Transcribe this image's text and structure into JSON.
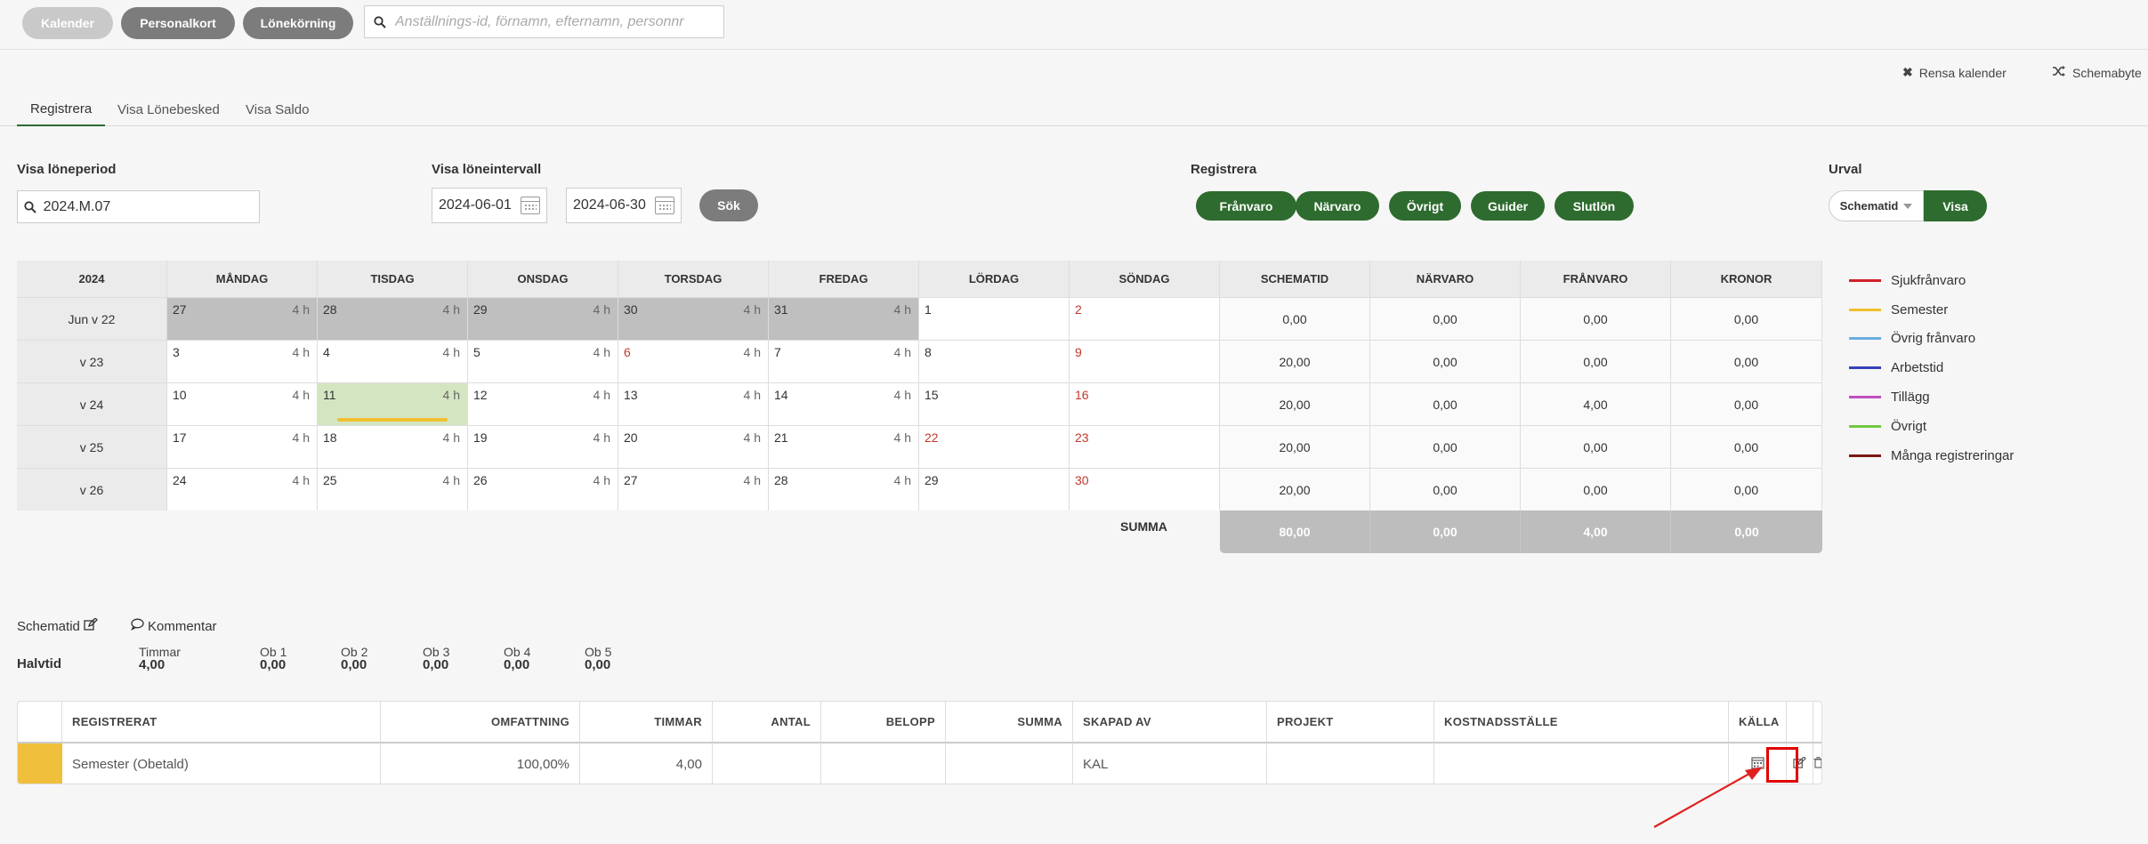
{
  "topnav": {
    "kalender": "Kalender",
    "personalkort": "Personalkort",
    "lonekorning": "Lönekörning",
    "search_placeholder": "Anställnings-id, förnamn, efternamn, personnr"
  },
  "actions": {
    "rensa": "Rensa kalender",
    "schemabyte": "Schemabyte"
  },
  "tabs": [
    "Registrera",
    "Visa Lönebesked",
    "Visa Saldo"
  ],
  "filters": {
    "loneperiod_label": "Visa löneperiod",
    "loneperiod_value": "2024.M.07",
    "intervall_label": "Visa löneintervall",
    "from_date": "2024-06-01",
    "to_date": "2024-06-30",
    "sok": "Sök"
  },
  "registrera": {
    "label": "Registrera",
    "buttons": [
      "Frånvaro",
      "Närvaro",
      "Övrigt",
      "Guider",
      "Slutlön"
    ]
  },
  "urval": {
    "label": "Urval",
    "selected": "Schematid",
    "visa": "Visa"
  },
  "calendar": {
    "year": "2024",
    "day_headers": [
      "MÅNDAG",
      "TISDAG",
      "ONSDAG",
      "TORSDAG",
      "FREDAG",
      "LÖRDAG",
      "SÖNDAG"
    ],
    "sum_headers": [
      "SCHEMATID",
      "NÄRVARO",
      "FRÅNVARO",
      "KRONOR"
    ],
    "weeks": [
      {
        "label": "Jun v 22",
        "days": [
          {
            "n": "27",
            "h": "4 h",
            "state": "past"
          },
          {
            "n": "28",
            "h": "4 h",
            "state": "past"
          },
          {
            "n": "29",
            "h": "4 h",
            "state": "past"
          },
          {
            "n": "30",
            "h": "4 h",
            "state": "past"
          },
          {
            "n": "31",
            "h": "4 h",
            "state": "past"
          },
          {
            "n": "1",
            "h": ""
          },
          {
            "n": "2",
            "h": "",
            "red": true
          }
        ],
        "sums": [
          "0,00",
          "0,00",
          "0,00",
          "0,00"
        ]
      },
      {
        "label": "v 23",
        "days": [
          {
            "n": "3",
            "h": "4 h"
          },
          {
            "n": "4",
            "h": "4 h"
          },
          {
            "n": "5",
            "h": "4 h"
          },
          {
            "n": "6",
            "h": "4 h",
            "red": true
          },
          {
            "n": "7",
            "h": "4 h"
          },
          {
            "n": "8",
            "h": ""
          },
          {
            "n": "9",
            "h": "",
            "red": true
          }
        ],
        "sums": [
          "20,00",
          "0,00",
          "0,00",
          "0,00"
        ]
      },
      {
        "label": "v 24",
        "days": [
          {
            "n": "10",
            "h": "4 h"
          },
          {
            "n": "11",
            "h": "4 h",
            "state": "sel",
            "bar": true
          },
          {
            "n": "12",
            "h": "4 h"
          },
          {
            "n": "13",
            "h": "4 h"
          },
          {
            "n": "14",
            "h": "4 h"
          },
          {
            "n": "15",
            "h": ""
          },
          {
            "n": "16",
            "h": "",
            "red": true
          }
        ],
        "sums": [
          "20,00",
          "0,00",
          "4,00",
          "0,00"
        ]
      },
      {
        "label": "v 25",
        "days": [
          {
            "n": "17",
            "h": "4 h"
          },
          {
            "n": "18",
            "h": "4 h"
          },
          {
            "n": "19",
            "h": "4 h"
          },
          {
            "n": "20",
            "h": "4 h"
          },
          {
            "n": "21",
            "h": "4 h"
          },
          {
            "n": "22",
            "h": "",
            "red": true
          },
          {
            "n": "23",
            "h": "",
            "red": true
          }
        ],
        "sums": [
          "20,00",
          "0,00",
          "0,00",
          "0,00"
        ]
      },
      {
        "label": "v 26",
        "days": [
          {
            "n": "24",
            "h": "4 h"
          },
          {
            "n": "25",
            "h": "4 h"
          },
          {
            "n": "26",
            "h": "4 h"
          },
          {
            "n": "27",
            "h": "4 h"
          },
          {
            "n": "28",
            "h": "4 h"
          },
          {
            "n": "29",
            "h": ""
          },
          {
            "n": "30",
            "h": "",
            "red": true
          }
        ],
        "sums": [
          "20,00",
          "0,00",
          "0,00",
          "0,00"
        ]
      }
    ],
    "summa_label": "SUMMA",
    "totals": [
      "80,00",
      "0,00",
      "4,00",
      "0,00"
    ]
  },
  "legend": [
    {
      "label": "Sjukfrånvaro",
      "color": "#d0202a"
    },
    {
      "label": "Semester",
      "color": "#f0c030"
    },
    {
      "label": "Övrig frånvaro",
      "color": "#6aaee0"
    },
    {
      "label": "Arbetstid",
      "color": "#3840b8"
    },
    {
      "label": "Tillägg",
      "color": "#c050c0"
    },
    {
      "label": "Övrigt",
      "color": "#70c840"
    },
    {
      "label": "Många registreringar",
      "color": "#7a1a14"
    }
  ],
  "schema": {
    "schematid_link": "Schematid",
    "kommentar_link": "Kommentar",
    "schema_name": "Halvtid",
    "cols": [
      {
        "label": "Timmar",
        "value": "4,00"
      },
      {
        "label": "Ob 1",
        "value": "0,00"
      },
      {
        "label": "Ob 2",
        "value": "0,00"
      },
      {
        "label": "Ob 3",
        "value": "0,00"
      },
      {
        "label": "Ob 4",
        "value": "0,00"
      },
      {
        "label": "Ob 5",
        "value": "0,00"
      }
    ]
  },
  "reg_table": {
    "headers": [
      "REGISTRERAT",
      "OMFATTNING",
      "TIMMAR",
      "ANTAL",
      "BELOPP",
      "SUMMA",
      "SKAPAD AV",
      "PROJEKT",
      "KOSTNADSSTÄLLE",
      "KÄLLA"
    ],
    "rows": [
      {
        "registrerat": "Semester (Obetald)",
        "omfattning": "100,00%",
        "timmar": "4,00",
        "antal": "",
        "belopp": "",
        "summa": "",
        "skapad_av": "KAL",
        "projekt": "",
        "kostnadsstalle": "",
        "color": "#f0c03c"
      }
    ]
  }
}
